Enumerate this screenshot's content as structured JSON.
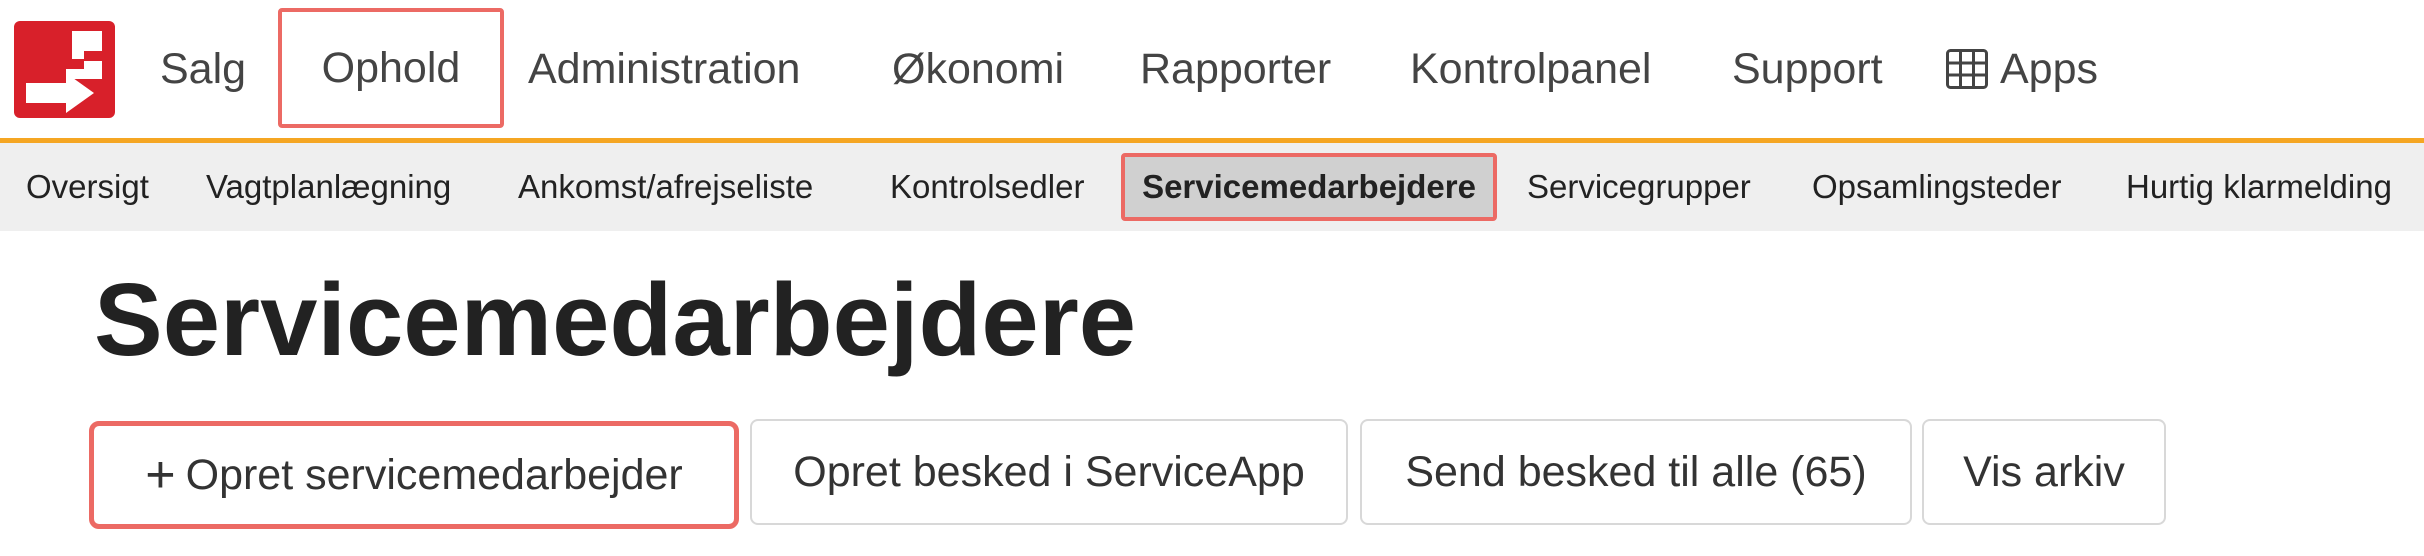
{
  "topnav": {
    "logo_icon": "company-logo-icon",
    "items": [
      {
        "label": "Salg"
      },
      {
        "label": "Ophold"
      },
      {
        "label": "Administration"
      },
      {
        "label": "Økonomi"
      },
      {
        "label": "Rapporter"
      },
      {
        "label": "Kontrolpanel"
      },
      {
        "label": "Support"
      },
      {
        "label": "Apps",
        "icon": "grid-icon"
      }
    ],
    "accent_color": "#f5a623"
  },
  "subnav": {
    "items": [
      {
        "label": "Oversigt"
      },
      {
        "label": "Vagtplanlægning"
      },
      {
        "label": "Ankomst/afrejseliste"
      },
      {
        "label": "Kontrolsedler"
      },
      {
        "label": "Servicemedarbejdere",
        "active": true
      },
      {
        "label": "Servicegrupper"
      },
      {
        "label": "Opsamlingsteder"
      },
      {
        "label": "Hurtig klarmelding"
      }
    ]
  },
  "page": {
    "title": "Servicemedarbejdere"
  },
  "actions": {
    "create_icon": "plus-icon",
    "create_label": "Opret servicemedarbejder",
    "message_label": "Opret besked i ServiceApp",
    "send_all_label": "Send besked til alle (65)",
    "archive_label": "Vis arkiv"
  },
  "colors": {
    "highlight_border": "#ec6a64",
    "logo_red": "#d8202a"
  }
}
